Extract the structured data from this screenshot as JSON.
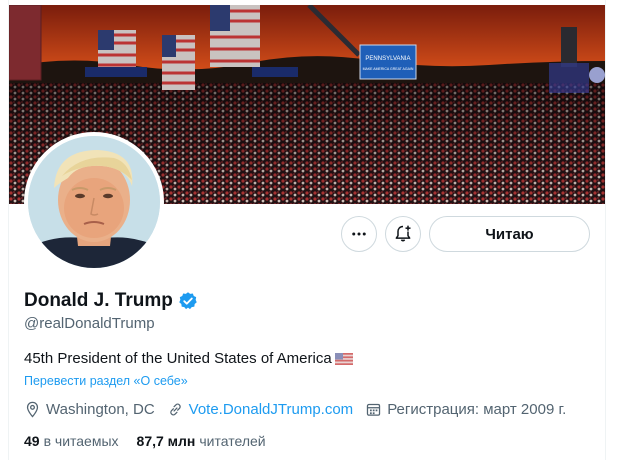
{
  "profile": {
    "name": "Donald J. Trump",
    "handle": "@realDonaldTrump",
    "bio": "45th President of the United States of America",
    "bio_flag": "us-flag-emoji",
    "translate_link": "Перевести раздел «О себе»",
    "location": "Washington, DC",
    "website": "Vote.DonaldJTrump.com",
    "joined": "Регистрация: март 2009 г.",
    "following_count": "49",
    "following_label": "в читаемых",
    "followers_count": "87,7 млн",
    "followers_label": "читателей"
  },
  "actions": {
    "more_icon": "more-horizontal-icon",
    "notify_icon": "bell-plus-icon",
    "follow_label": "Читаю"
  },
  "banner": {
    "signs": [
      "PENNSYLVANIA",
      "MAKE AMERICA GREAT AGAIN"
    ]
  },
  "colors": {
    "link": "#1d9bf0",
    "secondary_text": "#536471",
    "primary_text": "#0f1419",
    "verified": "#1d9bf0"
  }
}
